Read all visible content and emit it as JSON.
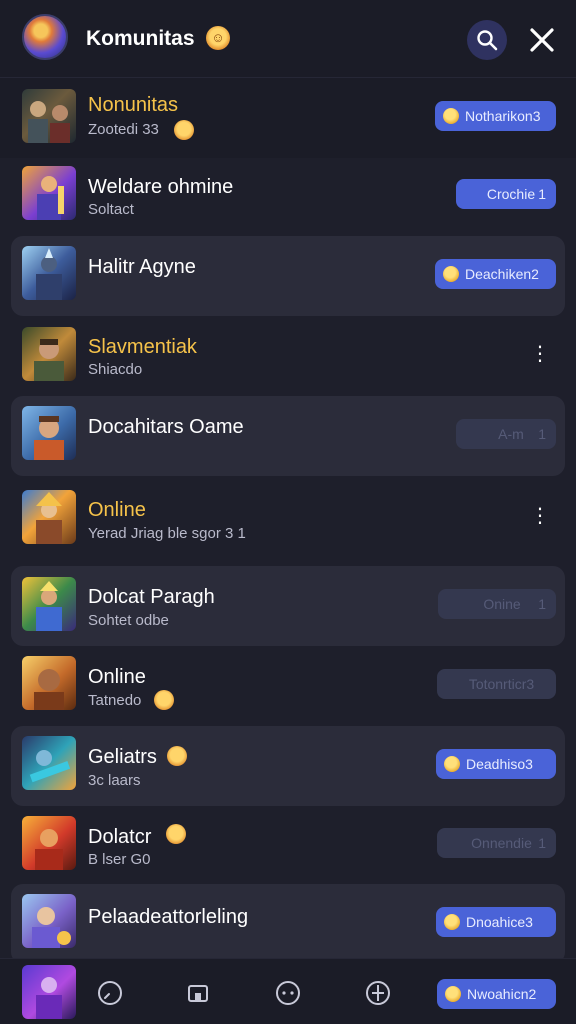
{
  "header": {
    "title": "Komunitas",
    "avatar_icon": "game-hero-avatar",
    "search_icon": "search-icon",
    "close_icon": "close-icon"
  },
  "rows": [
    {
      "name": "Nonunitas",
      "sub": "Zootedi 33",
      "pill": "Notharikon3",
      "pill_num": "",
      "highlight": "gold"
    },
    {
      "name": "Weldare ohmine",
      "sub": "Soltact",
      "pill": "Crochie",
      "pill_num": "1"
    },
    {
      "name": "Halitr Agyne",
      "sub": "",
      "pill": "Deachiken2",
      "pill_num": ""
    },
    {
      "name": "Slavmentiak",
      "sub": "Shiacdo",
      "pill": "",
      "pill_num": "",
      "highlight": "gold"
    },
    {
      "name": "Docahitars Oame",
      "sub": "",
      "pill": "A-m",
      "pill_num": "1"
    },
    {
      "name": "Online",
      "sub": "Yerad Jriag ble sgor 3 1",
      "pill": "",
      "pill_num": "",
      "highlight": "gold"
    },
    {
      "name": "Dolcat Paragh",
      "sub": "Sohtet odbe",
      "pill": "Onine",
      "pill_num": "1"
    },
    {
      "name": "Online",
      "sub": "Tatnedo",
      "pill": "Totonrticr3",
      "pill_num": ""
    },
    {
      "name": "Geliatrs",
      "sub": "3c laars",
      "pill": "Deadhiso3",
      "pill_num": ""
    },
    {
      "name": "Dolatcr",
      "sub": "B lser G0",
      "pill": "Onnendie",
      "pill_num": "1"
    },
    {
      "name": "Pelaadeattorleling",
      "sub": "",
      "pill": "Dnoahice3",
      "pill_num": ""
    }
  ],
  "bottom_nav": {
    "items": [
      "home-icon",
      "store-icon",
      "chat-icon",
      "explore-icon"
    ],
    "pill": "Nwoahicn2"
  },
  "colors": {
    "background": "#1e1f2b",
    "accent": "#4a63d8",
    "gold": "#f6c34a"
  }
}
